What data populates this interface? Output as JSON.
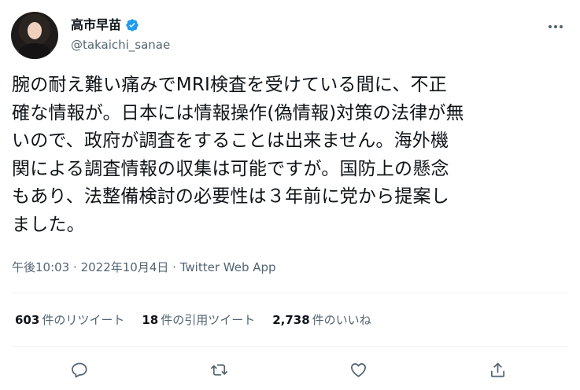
{
  "author": {
    "display_name": "高市早苗",
    "handle": "@takaichi_sanae",
    "verified": true
  },
  "tweet": {
    "text": "腕の耐え難い痛みでMRI検査を受けている間に、不正\n確な情報が。日本には情報操作(偽情報)対策の法律が無\nいので、政府が調査をすることは出来ません。海外機\n関による調査情報の収集は可能ですが。国防上の懸念\nもあり、法整備検討の必要性は３年前に党から提案し\nました。",
    "time": "午後10:03",
    "date": "2022年10月4日",
    "separator": "·",
    "source": "Twitter Web App"
  },
  "stats": {
    "retweets_count": "603",
    "retweets_label": "件のリツイート",
    "quotes_count": "18",
    "quotes_label": "件の引用ツイート",
    "likes_count": "2,738",
    "likes_label": "件のいいね"
  },
  "icons": {
    "reply": "reply-icon",
    "retweet": "retweet-icon",
    "like": "heart-icon",
    "share": "share-icon",
    "more": "more-icon",
    "verified": "verified-badge-icon"
  },
  "colors": {
    "text": "#0f1419",
    "secondary": "#536471",
    "verified": "#1d9bf0",
    "divider": "#eff3f4"
  }
}
